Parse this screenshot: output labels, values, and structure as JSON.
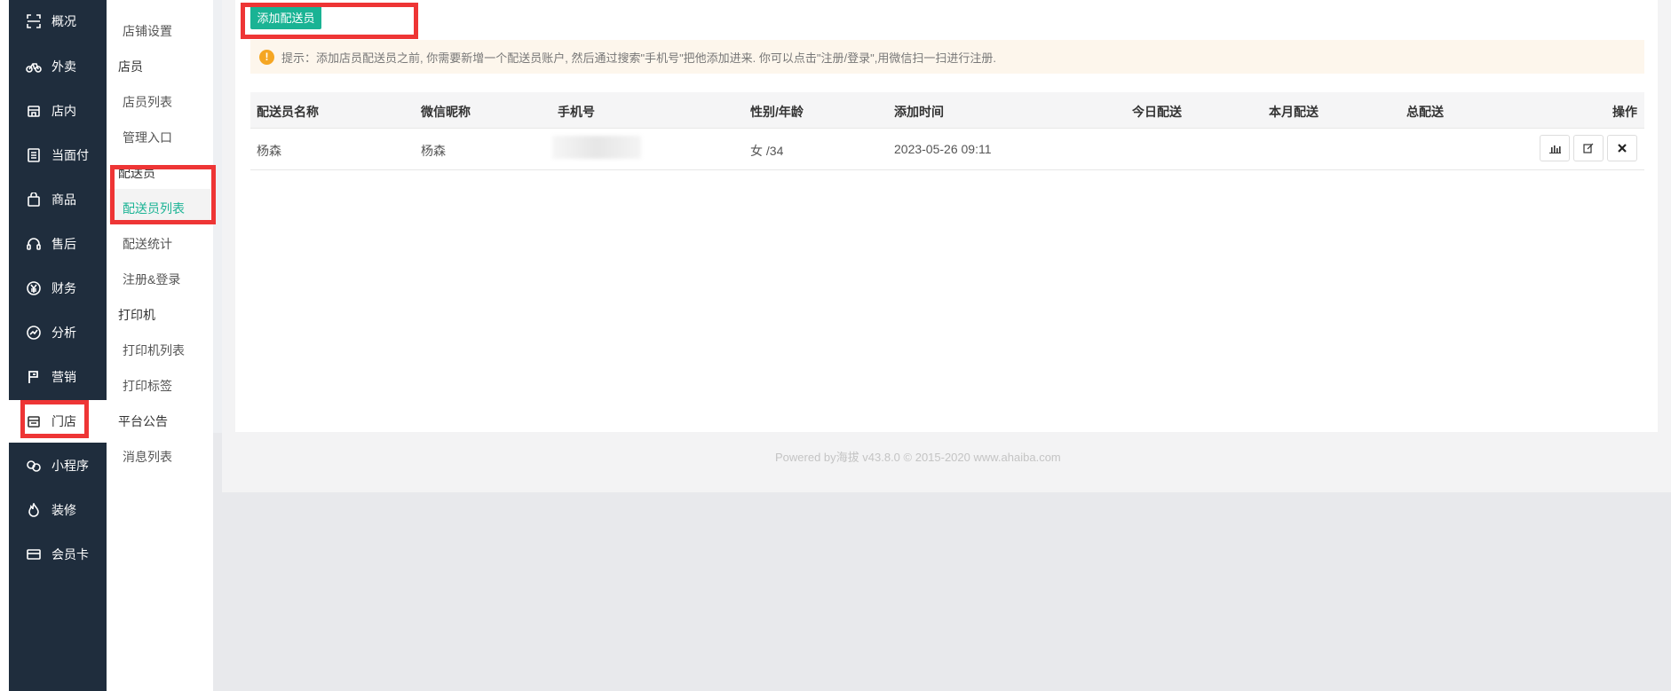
{
  "nav": [
    {
      "label": "概况",
      "icon": "scan-icon"
    },
    {
      "label": "外卖",
      "icon": "bike-icon"
    },
    {
      "label": "店内",
      "icon": "store-icon"
    },
    {
      "label": "当面付",
      "icon": "list-icon"
    },
    {
      "label": "商品",
      "icon": "bag-icon"
    },
    {
      "label": "售后",
      "icon": "headset-icon"
    },
    {
      "label": "财务",
      "icon": "yen-icon"
    },
    {
      "label": "分析",
      "icon": "chart-icon"
    },
    {
      "label": "营销",
      "icon": "flag-icon"
    },
    {
      "label": "门店",
      "icon": "shop-icon"
    },
    {
      "label": "小程序",
      "icon": "miniapp-icon"
    },
    {
      "label": "装修",
      "icon": "fire-icon"
    },
    {
      "label": "会员卡",
      "icon": "card-icon"
    }
  ],
  "subnav": {
    "store_settings": "店铺设置",
    "staff_heading": "店员",
    "staff_list": "店员列表",
    "admin_entry": "管理入口",
    "courier_heading": "配送员",
    "courier_list": "配送员列表",
    "delivery_stats": "配送统计",
    "register_login": "注册&登录",
    "printer_heading": "打印机",
    "printer_list": "打印机列表",
    "print_label": "打印标签",
    "notice_heading": "平台公告",
    "message_list": "消息列表"
  },
  "add_button": "添加配送员",
  "tip": "提示：添加店员配送员之前, 你需要新增一个配送员账户, 然后通过搜索\"手机号\"把他添加进来. 你可以点击\"注册/登录\",用微信扫一扫进行注册.",
  "table": {
    "headers": [
      "配送员名称",
      "微信昵称",
      "手机号",
      "性别/年龄",
      "添加时间",
      "今日配送",
      "本月配送",
      "总配送",
      "操作"
    ],
    "rows": [
      {
        "name": "杨森",
        "wechat": "杨森",
        "phone": "",
        "gender_age": "女 /34",
        "added": "2023-05-26 09:11",
        "today": "",
        "month": "",
        "total": ""
      }
    ]
  },
  "footer": "Powered by海拔 v43.8.0 © 2015-2020 www.ahaiba.com",
  "colors": {
    "sidebar": "#1f2d3d",
    "accent": "#1ab394",
    "highlight": "#ee3535",
    "tip_bg": "#fdf6ec"
  }
}
